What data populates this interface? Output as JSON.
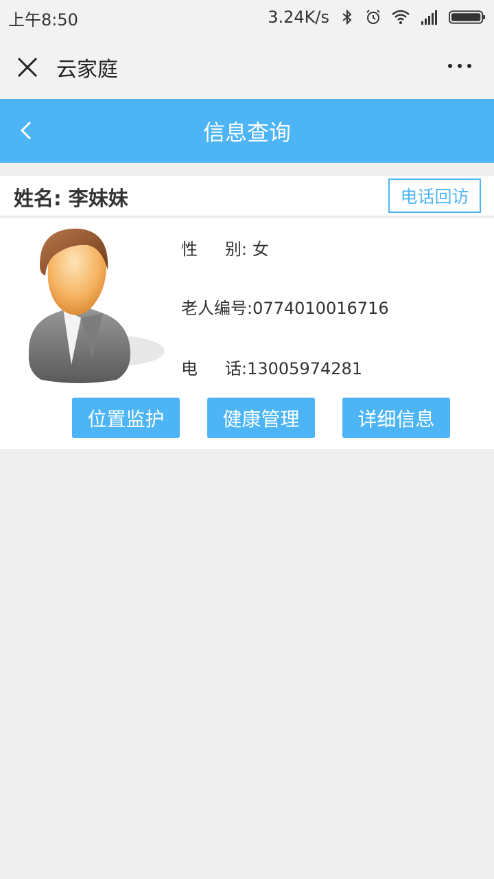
{
  "status_bar": {
    "time": "上午8:50",
    "net_speed": "3.24K/s",
    "icons": [
      "bluetooth-icon",
      "alarm-icon",
      "wifi-icon",
      "signal-icon",
      "battery-icon"
    ]
  },
  "app_bar": {
    "title": "云家庭",
    "close_icon": "close-icon",
    "more_icon": "more-icon"
  },
  "nav_bar": {
    "title": "信息查询",
    "back_icon": "back-arrow-icon",
    "color": "#4db5f5"
  },
  "profile": {
    "name_label": "姓名:",
    "name": "李妹妹",
    "callback_button": "电话回访",
    "avatar_icon": "user-avatar-icon",
    "gender_label_1": "性",
    "gender_label_2": "别:",
    "gender": "女",
    "elder_id_label": "老人编号:",
    "elder_id": "0774010016716",
    "phone_label_1": "电",
    "phone_label_2": "话:",
    "phone": "13005974281"
  },
  "actions": {
    "location": "位置监护",
    "health": "健康管理",
    "details": "详细信息"
  }
}
